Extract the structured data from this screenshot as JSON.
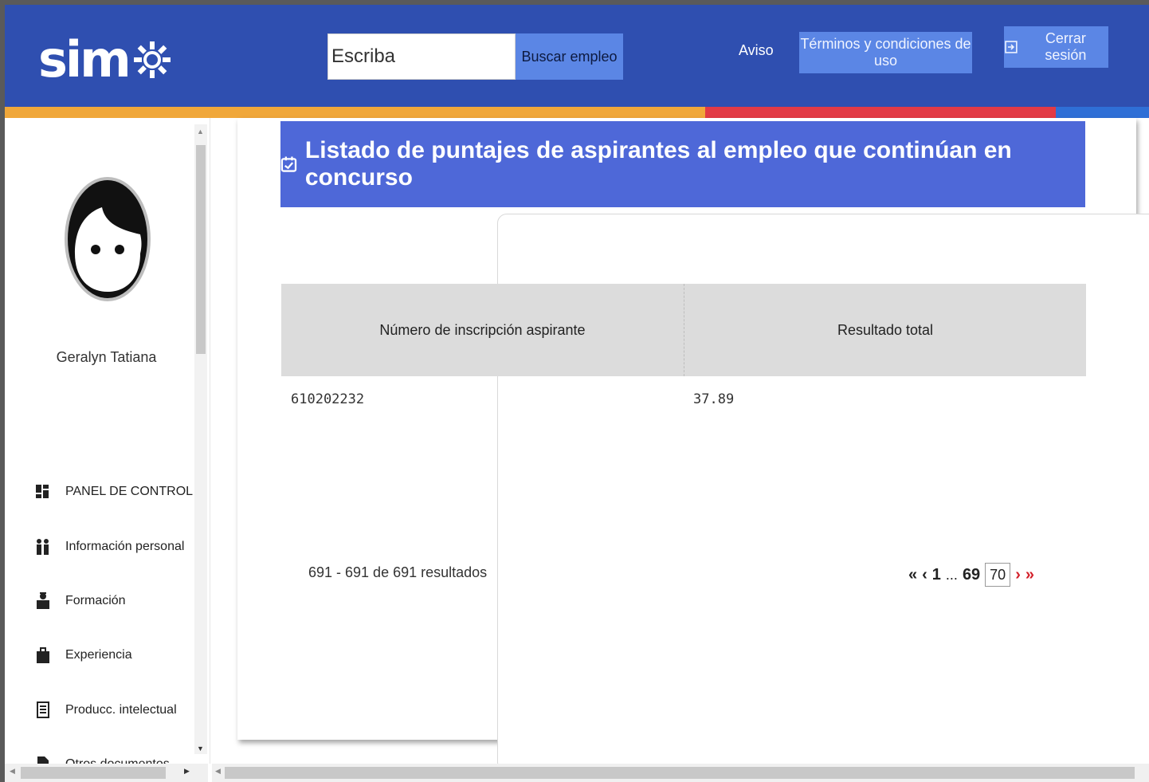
{
  "header": {
    "logo_text": "sim",
    "search_placeholder": "Escriba",
    "search_button": "Buscar empleo",
    "notice_link": "Aviso",
    "terms_button": "Términos y condiciones de uso",
    "logout_button": "Cerrar sesión",
    "colors": {
      "background": "#2f4fb0",
      "button": "#5b86e5"
    }
  },
  "strip_colors": [
    "#f0a73a",
    "#e23a45",
    "#2f6fd6"
  ],
  "sidebar": {
    "user_name": "Geralyn Tatiana",
    "items": [
      {
        "label": "PANEL DE CONTROL",
        "icon": "dashboard-icon"
      },
      {
        "label": "Información personal",
        "icon": "people-icon"
      },
      {
        "label": "Formación",
        "icon": "student-icon"
      },
      {
        "label": "Experiencia",
        "icon": "briefcase-icon"
      },
      {
        "label": "Producc. intelectual",
        "icon": "document-icon"
      },
      {
        "label": "Otros documentos",
        "icon": "file-icon"
      }
    ]
  },
  "main": {
    "title": "Listado de puntajes de aspirantes al empleo que continúan en concurso",
    "table": {
      "columns": [
        "Número de inscripción aspirante",
        "Resultado total"
      ],
      "rows": [
        [
          "610202232",
          "37.89"
        ]
      ]
    },
    "results_summary": "691 - 691 de 691 resultados",
    "pagination": {
      "first": "«",
      "prev": "‹",
      "first_page": "1",
      "ellipsis": "...",
      "prev_page": "69",
      "current_page": "70",
      "next": "›",
      "last": "»"
    }
  }
}
